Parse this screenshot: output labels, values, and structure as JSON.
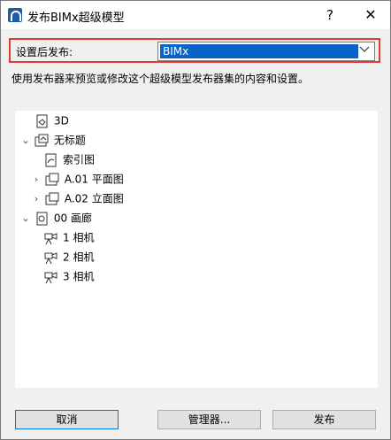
{
  "window": {
    "title": "发布BIMx超级模型",
    "help_label": "?",
    "close_label": "✕"
  },
  "publish_row": {
    "label": "设置后发布:",
    "selected": "BIMx"
  },
  "description": "使用发布器来预览或修改这个超级模型发布器集的内容和设置。",
  "tree": {
    "items": [
      {
        "label": "3D",
        "icon": "model-3d-icon"
      },
      {
        "label": "无标题",
        "icon": "layout-folder-icon"
      },
      {
        "label": "索引图",
        "icon": "index-map-icon"
      },
      {
        "label": "A.01 平面图",
        "icon": "plan-folder-icon"
      },
      {
        "label": "A.02 立面图",
        "icon": "elevation-folder-icon"
      },
      {
        "label": "00 画廊",
        "icon": "gallery-icon"
      },
      {
        "label": "1 相机",
        "icon": "camera-icon"
      },
      {
        "label": "2 相机",
        "icon": "camera-icon"
      },
      {
        "label": "3 相机",
        "icon": "camera-icon"
      }
    ]
  },
  "buttons": {
    "cancel": "取消",
    "manager": "管理器...",
    "publish": "发布"
  }
}
